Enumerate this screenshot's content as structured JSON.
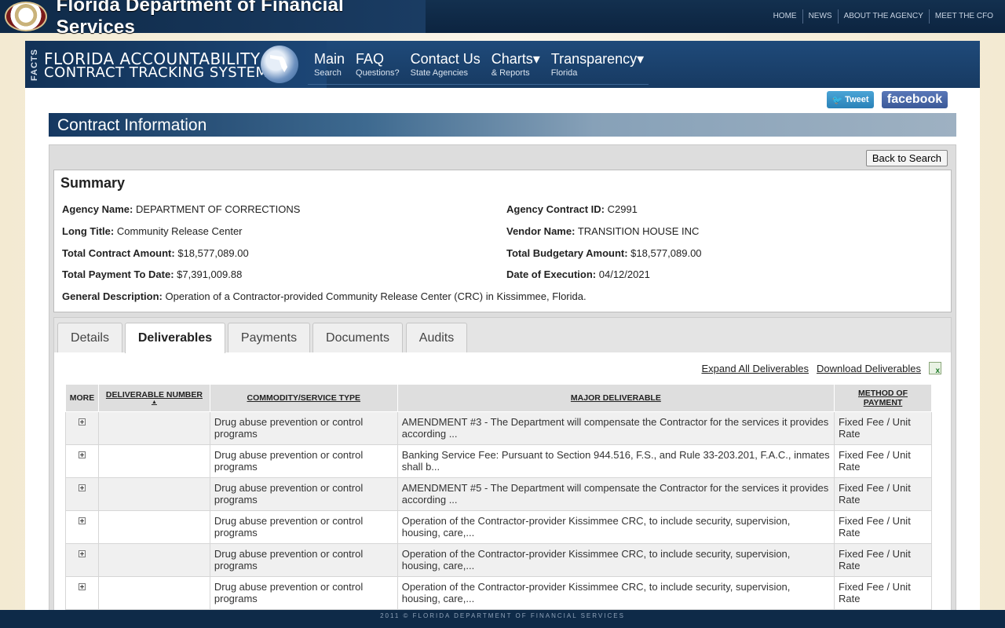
{
  "header": {
    "title": "Florida Department of Financial Services",
    "nav": [
      "HOME",
      "NEWS",
      "ABOUT THE AGENCY",
      "MEET THE CFO"
    ]
  },
  "facts": {
    "vertical": "FACTS",
    "line1": "FLORIDA  ACCOUNTABILITY",
    "line2": "CONTRACT TRACKING SYSTEM"
  },
  "main_nav": [
    {
      "big": "Main",
      "small": "Search"
    },
    {
      "big": "FAQ",
      "small": "Questions?"
    },
    {
      "big": "Contact Us",
      "small": "State Agencies"
    },
    {
      "big": "Charts▾",
      "small": "& Reports"
    },
    {
      "big": "Transparency▾",
      "small": "Florida"
    }
  ],
  "social": {
    "tweet": "Tweet",
    "facebook": "facebook"
  },
  "page_title": "Contract Information",
  "back_button": "Back to Search",
  "summary": {
    "title": "Summary",
    "agency_name_label": "Agency Name:",
    "agency_name": "DEPARTMENT OF CORRECTIONS",
    "agency_contract_id_label": "Agency Contract ID:",
    "agency_contract_id": "C2991",
    "long_title_label": "Long Title:",
    "long_title": "Community Release Center",
    "vendor_name_label": "Vendor Name:",
    "vendor_name": "TRANSITION HOUSE INC",
    "total_contract_amount_label": "Total Contract Amount:",
    "total_contract_amount": "$18,577,089.00",
    "total_budgetary_amount_label": "Total Budgetary Amount:",
    "total_budgetary_amount": "$18,577,089.00",
    "total_payment_label": "Total Payment To Date:",
    "total_payment": "$7,391,009.88",
    "date_of_execution_label": "Date of Execution:",
    "date_of_execution": "04/12/2021",
    "general_description_label": "General Description:",
    "general_description": "Operation of a Contractor-provided Community Release Center (CRC) in Kissimmee, Florida."
  },
  "tabs": [
    "Details",
    "Deliverables",
    "Payments",
    "Documents",
    "Audits"
  ],
  "actions": {
    "expand": "Expand All Deliverables",
    "download": "Download Deliverables"
  },
  "table": {
    "headers": {
      "more": "MORE",
      "number": "DELIVERABLE NUMBER",
      "commodity": "COMMODITY/SERVICE TYPE",
      "major": "MAJOR DELIVERABLE",
      "method": "METHOD OF PAYMENT"
    },
    "rows": [
      {
        "number": "",
        "commodity": "Drug abuse prevention or control programs",
        "major": "AMENDMENT #3 - The Department will compensate the Contractor for the services it provides according ...",
        "method": "Fixed Fee / Unit Rate"
      },
      {
        "number": "",
        "commodity": "Drug abuse prevention or control programs",
        "major": "Banking Service Fee: Pursuant to Section 944.516, F.S., and Rule 33-203.201, F.A.C., inmates shall b...",
        "method": "Fixed Fee / Unit Rate"
      },
      {
        "number": "",
        "commodity": "Drug abuse prevention or control programs",
        "major": "AMENDMENT #5 - The Department will compensate the Contractor for the services it provides according ...",
        "method": "Fixed Fee / Unit Rate"
      },
      {
        "number": "",
        "commodity": "Drug abuse prevention or control programs",
        "major": "Operation of the Contractor-provider Kissimmee CRC, to include security, supervision, housing, care,...",
        "method": "Fixed Fee / Unit Rate"
      },
      {
        "number": "",
        "commodity": "Drug abuse prevention or control programs",
        "major": "Operation of the Contractor-provider Kissimmee CRC, to include security, supervision, housing, care,...",
        "method": "Fixed Fee / Unit Rate"
      },
      {
        "number": "",
        "commodity": "Drug abuse prevention or control programs",
        "major": "Operation of the Contractor-provider Kissimmee CRC, to include security, supervision, housing, care,...",
        "method": "Fixed Fee / Unit Rate"
      }
    ]
  },
  "footer": "2011 © FLORIDA DEPARTMENT OF FINANCIAL SERVICES"
}
